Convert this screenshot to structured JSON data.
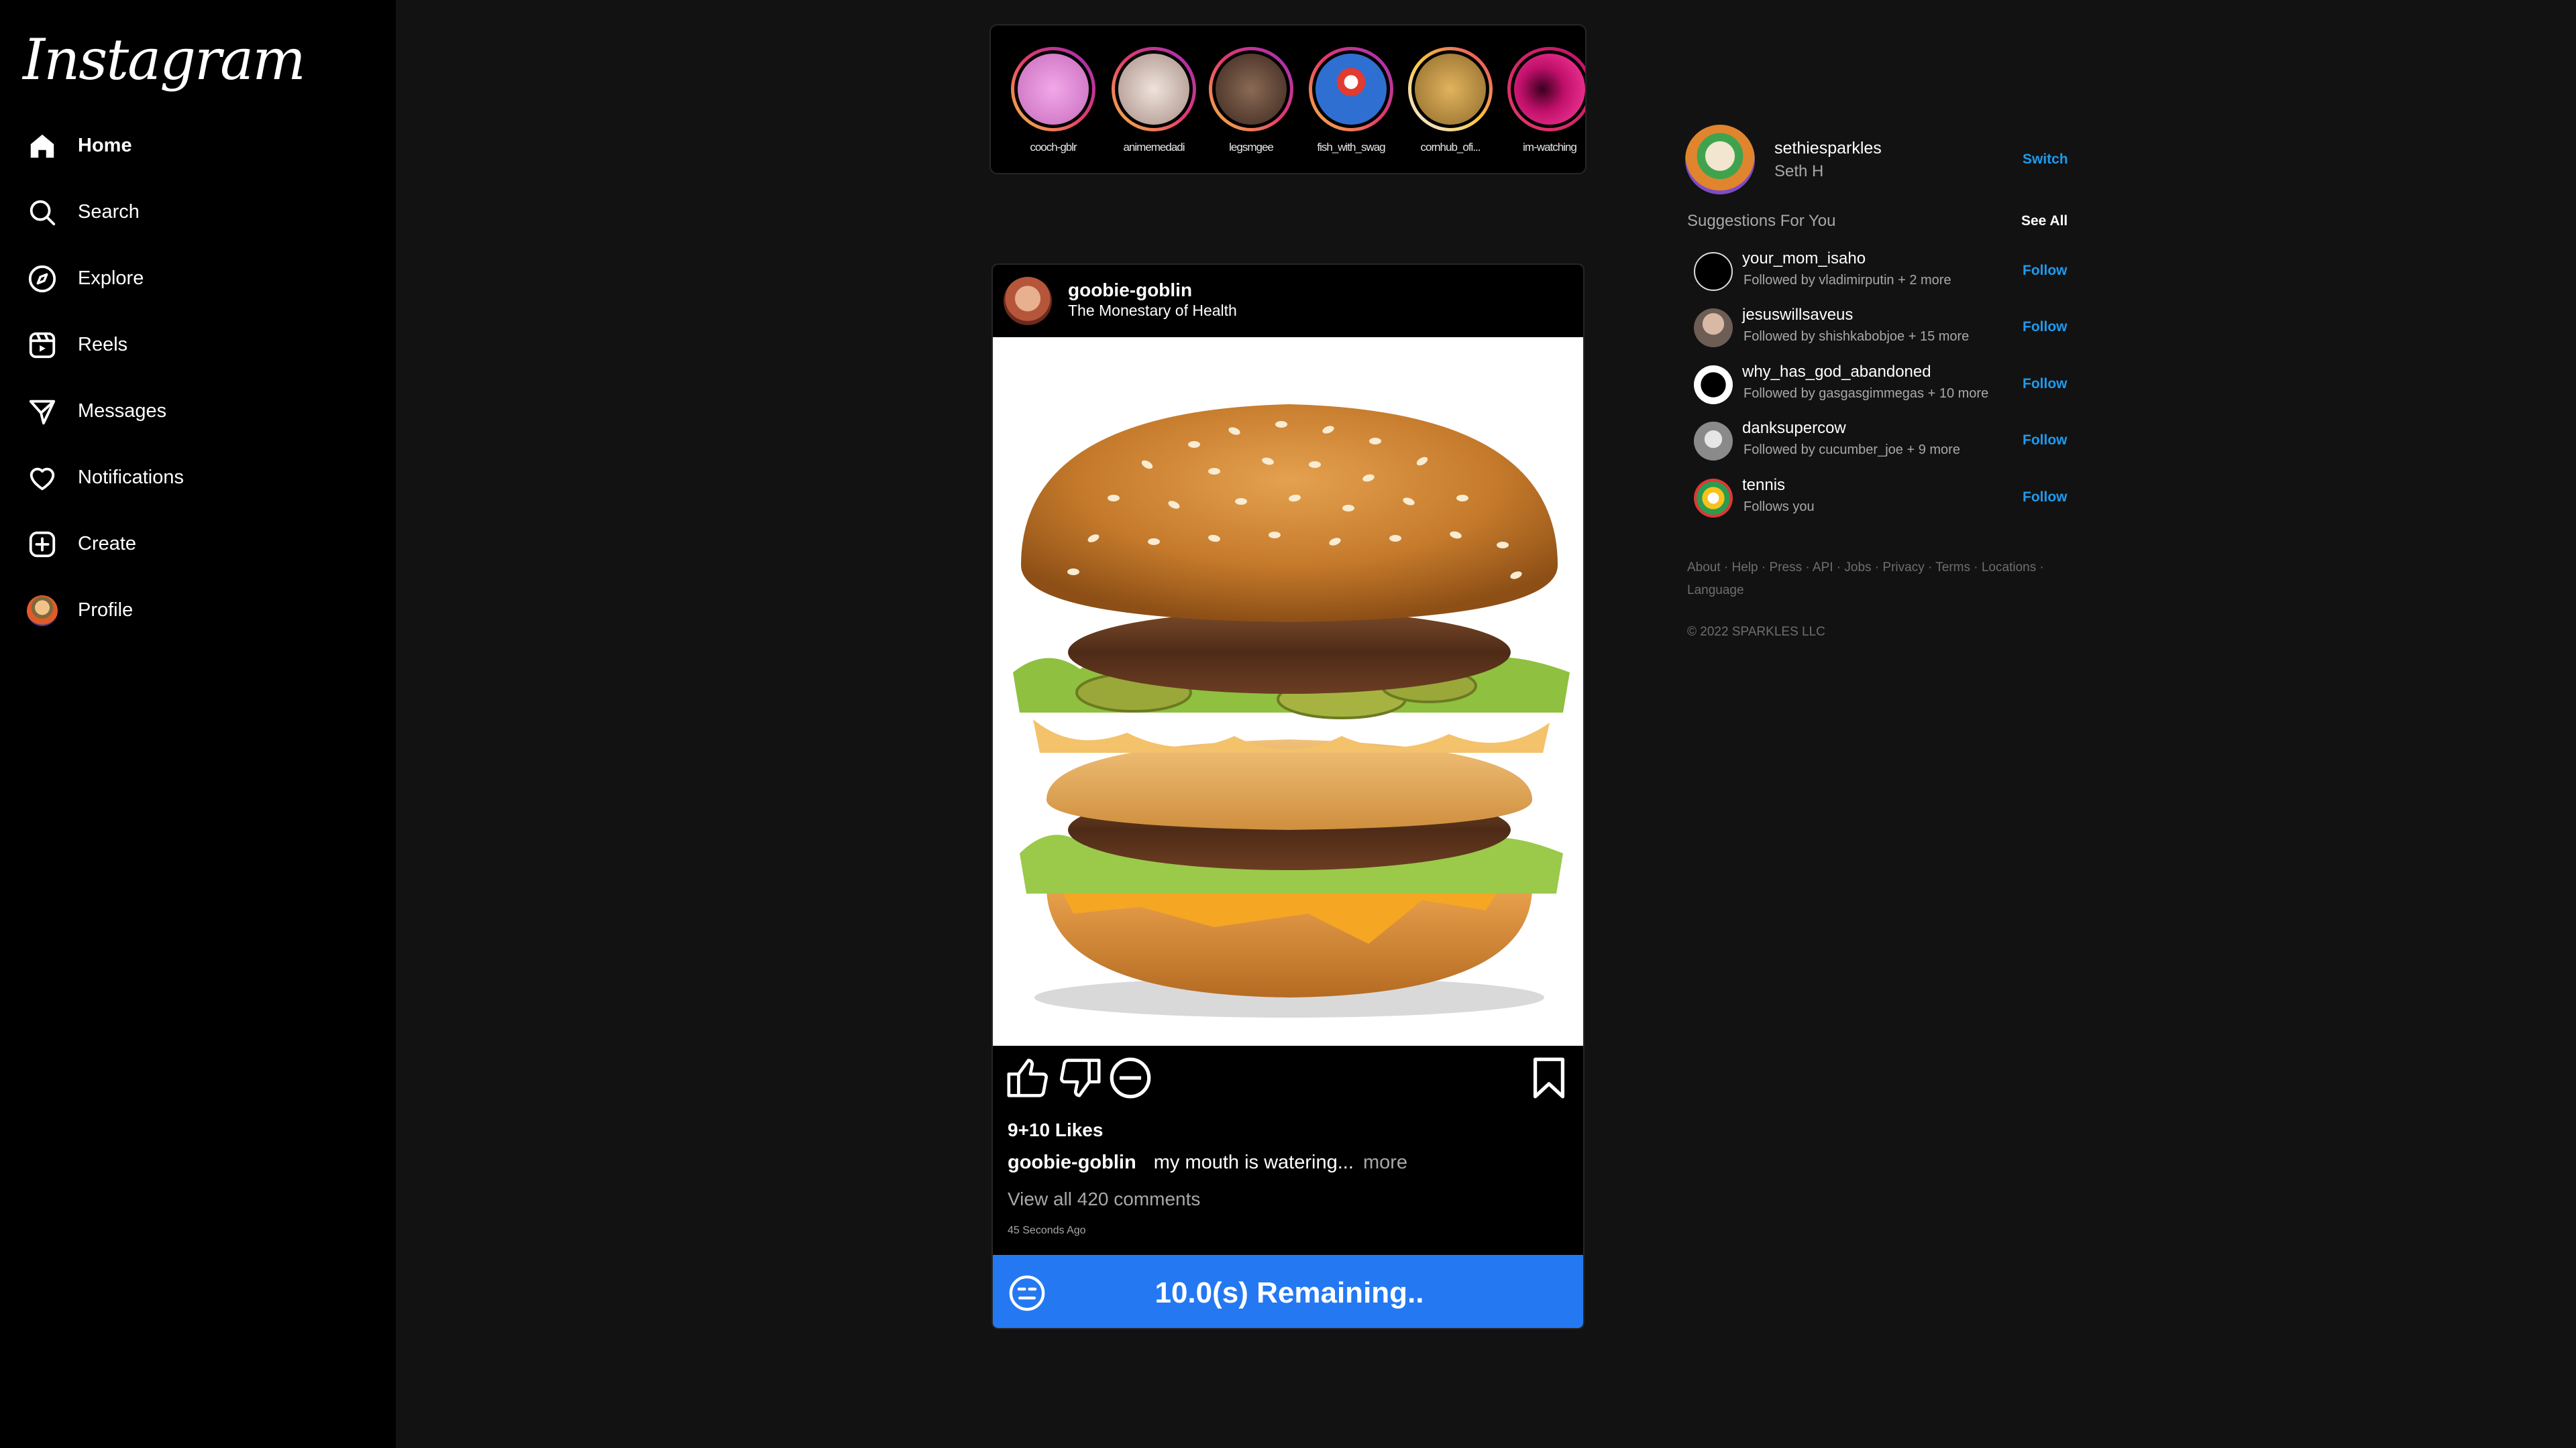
{
  "app": {
    "logo": "Instagram"
  },
  "nav": {
    "items": [
      {
        "label": "Home",
        "icon": "home-icon"
      },
      {
        "label": "Search",
        "icon": "search-icon"
      },
      {
        "label": "Explore",
        "icon": "compass-icon"
      },
      {
        "label": "Reels",
        "icon": "reels-icon"
      },
      {
        "label": "Messages",
        "icon": "send-icon"
      },
      {
        "label": "Notifications",
        "icon": "heart-icon"
      },
      {
        "label": "Create",
        "icon": "plus-square-icon"
      },
      {
        "label": "Profile",
        "icon": "avatar"
      }
    ]
  },
  "stories": [
    {
      "username": "cooch-gblr",
      "color": "#d98bd4"
    },
    {
      "username": "animemedadi",
      "color": "#c8b7b0"
    },
    {
      "username": "legsmgee",
      "color": "#5a3d30"
    },
    {
      "username": "fish_with_swag",
      "color": "#2f6fd1"
    },
    {
      "username": "cornhub_ofi...",
      "color": "#c79b4a"
    },
    {
      "username": "im-watching",
      "color": "#c0106a"
    }
  ],
  "post": {
    "username": "goobie-goblin",
    "subtitle": "The Monestary of Health",
    "likes": "9+10 Likes",
    "caption_user": "goobie-goblin",
    "caption_text": "my mouth is watering...",
    "caption_more": "more",
    "comments_link": "View all 420 comments",
    "time_ago": "45 Seconds Ago",
    "timer_text": "10.0(s) Remaining..",
    "timer_color": "#2479f3"
  },
  "me": {
    "username": "sethiesparkles",
    "name": "Seth H",
    "switch_label": "Switch"
  },
  "suggestions": {
    "title": "Suggestions For You",
    "see_all": "See All",
    "follow_label": "Follow",
    "items": [
      {
        "username": "your_mom_isaho",
        "sub": "Followed by vladimirputin  + 2 more"
      },
      {
        "username": "jesuswillsaveus",
        "sub": "Followed by shishkabobjoe  + 15 more"
      },
      {
        "username": "why_has_god_abandoned",
        "sub": "Followed by gasgasgimmegas  + 10 more"
      },
      {
        "username": "danksupercow",
        "sub": "Followed by cucumber_joe  + 9 more"
      },
      {
        "username": "tennis",
        "sub": "Follows you"
      }
    ]
  },
  "footer": {
    "links": "About · Help · Press · API · Jobs · Privacy · Terms · Locations · Language",
    "copyright": "© 2022  SPARKLES LLC"
  },
  "colors": {
    "accent": "#1d9bf0",
    "background": "#121212",
    "sidebar": "#000000"
  }
}
